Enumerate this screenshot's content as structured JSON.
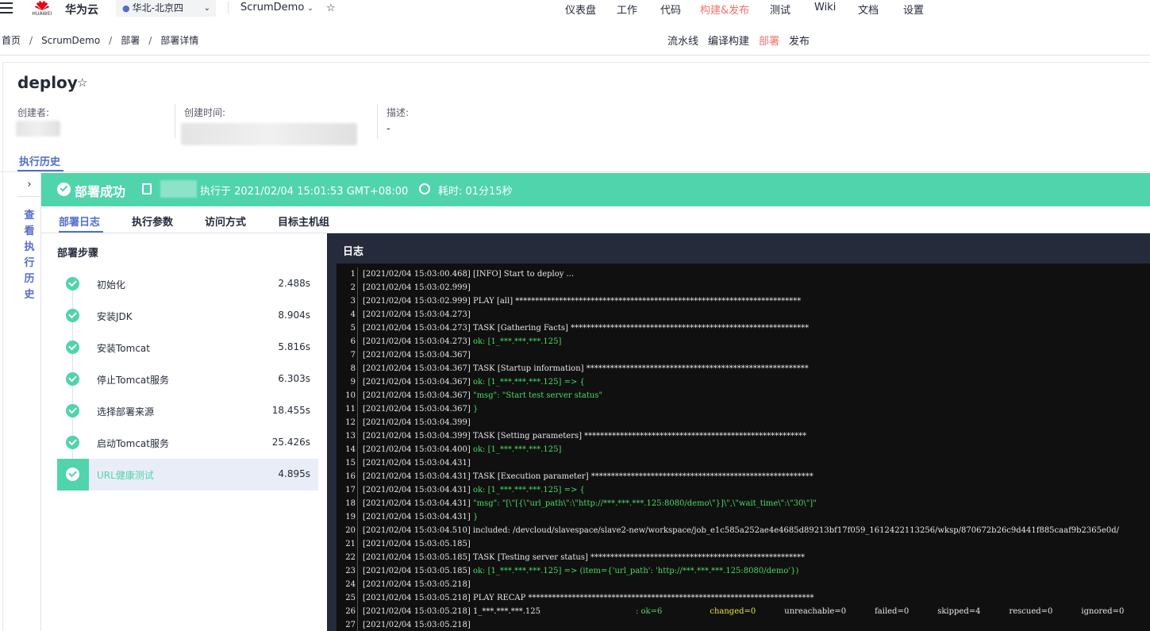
{
  "topbar": {
    "brand": "华为云",
    "logo_text": "HUAWEI",
    "region": "华北-北京四",
    "project": "ScrumDemo",
    "nav": [
      "仪表盘",
      "工作",
      "代码",
      "构建&发布",
      "测试",
      "Wiki",
      "文档",
      "设置"
    ],
    "active_nav": "构建&发布"
  },
  "breadcrumb": [
    "首页",
    "ScrumDemo",
    "部署",
    "部署详情"
  ],
  "subnav": [
    "流水线",
    "编译构建",
    "部署",
    "发布"
  ],
  "page": {
    "title": "deploy",
    "creator_label": "创建者:",
    "created_time_label": "创建时间:",
    "description_label": "描述:",
    "description_value": "-",
    "history_tab": "执行历史",
    "view_history": [
      "查",
      "看",
      "执",
      "行",
      "历",
      "史"
    ]
  },
  "banner": {
    "status": "部署成功",
    "exec_text": "执行于 2021/02/04 15:01:53 GMT+08:00",
    "duration_text": "耗时: 01分15秒",
    "color": "#50d4ab"
  },
  "tabs": [
    "部署日志",
    "执行参数",
    "访问方式",
    "目标主机组"
  ],
  "steps_title": "部署步骤",
  "steps": [
    {
      "name": "初始化",
      "time": "2.488s"
    },
    {
      "name": "安装JDK",
      "time": "8.904s"
    },
    {
      "name": "安装Tomcat",
      "time": "5.816s"
    },
    {
      "name": "停止Tomcat服务",
      "time": "6.303s"
    },
    {
      "name": "选择部署来源",
      "time": "18.455s"
    },
    {
      "name": "启动Tomcat服务",
      "time": "25.426s"
    },
    {
      "name": "URL健康测试",
      "time": "4.895s"
    }
  ],
  "log": {
    "title": "日志",
    "lines": [
      {
        "n": "1",
        "ts": "[2021/02/04 15:03:00.468]",
        "text": " [INFO]  Start to deploy ...",
        "color": ""
      },
      {
        "n": "2",
        "ts": "[2021/02/04 15:03:02.999]",
        "text": "",
        "color": ""
      },
      {
        "n": "3",
        "ts": "[2021/02/04 15:03:02.999]",
        "text": " PLAY [all] ************************************************************************",
        "color": ""
      },
      {
        "n": "4",
        "ts": "[2021/02/04 15:03:04.273]",
        "text": "",
        "color": ""
      },
      {
        "n": "5",
        "ts": "[2021/02/04 15:03:04.273]",
        "text": " TASK [Gathering Facts] ************************************************************",
        "color": ""
      },
      {
        "n": "6",
        "ts": "[2021/02/04 15:03:04.273]",
        "text": " ok: [1_***.***.***.125]",
        "color": "green"
      },
      {
        "n": "7",
        "ts": "[2021/02/04 15:03:04.367]",
        "text": "",
        "color": ""
      },
      {
        "n": "8",
        "ts": "[2021/02/04 15:03:04.367]",
        "text": " TASK [Startup information] ********************************************************",
        "color": ""
      },
      {
        "n": "9",
        "ts": "[2021/02/04 15:03:04.367]",
        "text": " ok: [1_***.***.***.125] => {",
        "color": "green"
      },
      {
        "n": "10",
        "ts": "[2021/02/04 15:03:04.367]",
        "text": "         \"msg\": \"Start test server status\"",
        "color": "green"
      },
      {
        "n": "11",
        "ts": "[2021/02/04 15:03:04.367]",
        "text": "  }",
        "color": "green"
      },
      {
        "n": "12",
        "ts": "[2021/02/04 15:03:04.399]",
        "text": "",
        "color": ""
      },
      {
        "n": "13",
        "ts": "[2021/02/04 15:03:04.399]",
        "text": " TASK [Setting  parameters] ********************************************************",
        "color": ""
      },
      {
        "n": "14",
        "ts": "[2021/02/04 15:03:04.400]",
        "text": " ok: [1_***.***.***.125]",
        "color": "green"
      },
      {
        "n": "15",
        "ts": "[2021/02/04 15:03:04.431]",
        "text": "",
        "color": ""
      },
      {
        "n": "16",
        "ts": "[2021/02/04 15:03:04.431]",
        "text": " TASK [Execution parameter] ********************************************************",
        "color": ""
      },
      {
        "n": "17",
        "ts": "[2021/02/04 15:03:04.431]",
        "text": " ok: [1_***.***.***.125] => {",
        "color": "green"
      },
      {
        "n": "18",
        "ts": "[2021/02/04 15:03:04.431]",
        "text": "         \"msg\": \"[\\\"[{\\\"url_path\\\":\\\"http://***.***.***.125:8080/demo\\\"}]\\\",\\\"wait_time\\\":\\\"30\\\"]\"",
        "color": "green"
      },
      {
        "n": "19",
        "ts": "[2021/02/04 15:03:04.431]",
        "text": "  }",
        "color": "green"
      },
      {
        "n": "20",
        "ts": "[2021/02/04 15:03:04.510]",
        "text": " included: /devcloud/slavespace/slave2-new/workspace/job_e1c585a252ae4e4685d89213bf17f059_1612422113256/wksp/870672b26c9d441f885caaf9b2365e0d/",
        "color": ""
      },
      {
        "n": "21",
        "ts": "[2021/02/04 15:03:05.185]",
        "text": "",
        "color": ""
      },
      {
        "n": "22",
        "ts": "[2021/02/04 15:03:05.185]",
        "text": " TASK [Testing server status] ******************************************************",
        "color": ""
      },
      {
        "n": "23",
        "ts": "[2021/02/04 15:03:05.185]",
        "text": " ok: [1_***.***.***.125] => (item={'url_path': 'http://***.***.***.125:8080/demo'})",
        "color": "green"
      },
      {
        "n": "24",
        "ts": "[2021/02/04 15:03:05.218]",
        "text": "",
        "color": ""
      },
      {
        "n": "25",
        "ts": "[2021/02/04 15:03:05.218]",
        "text": " PLAY RECAP ************************************************************************",
        "color": ""
      },
      {
        "n": "26",
        "ts": "[2021/02/04 15:03:05.218]",
        "text": " 1_***.***.***.125",
        "color": "",
        "recap": {
          "ok": "ok=6",
          "changed": "changed=0",
          "unreachable": "unreachable=0",
          "failed": "failed=0",
          "skipped": "skipped=4",
          "rescued": "rescued=0",
          "ignored": "ignored=0"
        }
      },
      {
        "n": "27",
        "ts": "[2021/02/04 15:03:05.218]",
        "text": "",
        "color": ""
      }
    ]
  }
}
